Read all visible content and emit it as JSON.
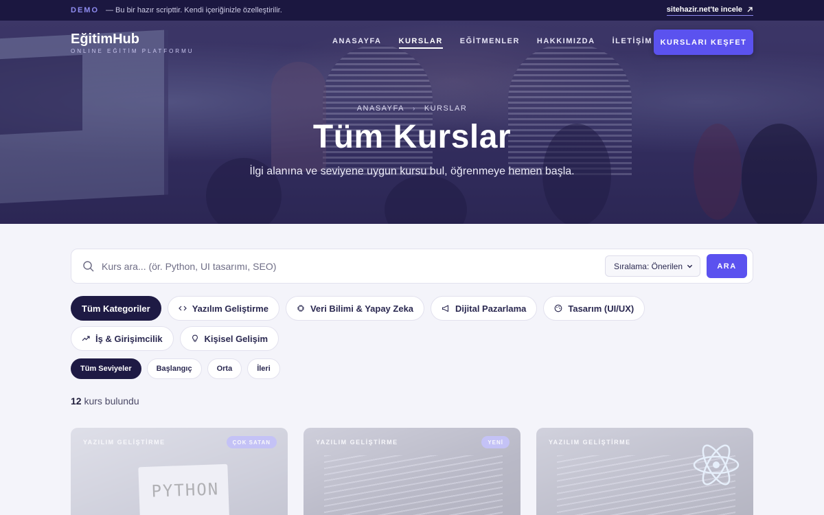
{
  "demo_bar": {
    "tag": "DEMO",
    "text": "— Bu bir hazır scripttir. Kendi içeriğinizle özelleştirilir.",
    "link": "sitehazir.net'te incele"
  },
  "brand": {
    "name": "EğitimHub",
    "tagline": "ONLINE EĞİTİM PLATFORMU"
  },
  "nav": {
    "items": [
      {
        "label": "ANASAYFA"
      },
      {
        "label": "KURSLAR"
      },
      {
        "label": "EĞİTMENLER"
      },
      {
        "label": "HAKKIMIZDA"
      },
      {
        "label": "İLETİŞİM"
      }
    ],
    "active": "KURSLAR",
    "cta": "KURSLARI KEŞFET"
  },
  "hero": {
    "breadcrumb": [
      "ANASAYFA",
      "KURSLAR"
    ],
    "title": "Tüm Kurslar",
    "subtitle": "İlgi alanına ve seviyene uygun kursu bul, öğrenmeye hemen başla."
  },
  "search": {
    "placeholder": "Kurs ara... (ör. Python, UI tasarımı, SEO)",
    "sort_label": "Sıralama: Önerilen",
    "button": "ARA"
  },
  "categories": [
    {
      "label": "Tüm Kategoriler",
      "icon": "none",
      "active": true
    },
    {
      "label": "Yazılım Geliştirme",
      "icon": "code-icon"
    },
    {
      "label": "Veri Bilimi & Yapay Zeka",
      "icon": "cpu-icon"
    },
    {
      "label": "Dijital Pazarlama",
      "icon": "megaphone-icon"
    },
    {
      "label": "Tasarım (UI/UX)",
      "icon": "palette-icon"
    },
    {
      "label": "İş & Girişimcilik",
      "icon": "trending-up-icon"
    },
    {
      "label": "Kişisel Gelişim",
      "icon": "lightbulb-icon"
    }
  ],
  "levels": [
    {
      "label": "Tüm Seviyeler",
      "active": true
    },
    {
      "label": "Başlangıç"
    },
    {
      "label": "Orta"
    },
    {
      "label": "İleri"
    }
  ],
  "results": {
    "count": "12",
    "suffix": "kurs bulundu"
  },
  "cards": [
    {
      "category": "YAZILIM GELİŞTİRME",
      "badge": "ÇOK SATAN",
      "image_text": "PYTHON"
    },
    {
      "category": "YAZILIM GELİŞTİRME",
      "badge": "YENİ"
    },
    {
      "category": "YAZILIM GELİŞTİRME"
    }
  ],
  "colors": {
    "accent": "#5b52ef",
    "dark": "#1e1a44",
    "demo_bar": "#1b1740"
  }
}
